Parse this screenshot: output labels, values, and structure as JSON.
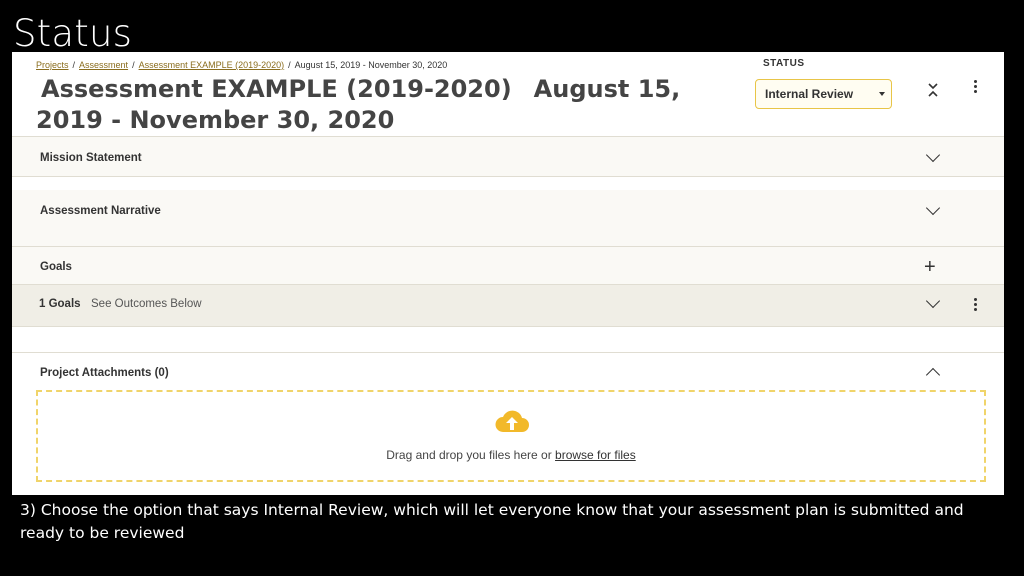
{
  "slide": {
    "title": "Status",
    "caption": "3) Choose the option that says Internal Review, which will let everyone know that your assessment plan is submitted and ready to be reviewed"
  },
  "breadcrumb": {
    "items": [
      "Projects",
      "Assessment",
      "Assessment EXAMPLE (2019-2020)"
    ],
    "current": "August 15, 2019 - November 30, 2020",
    "separator": "/"
  },
  "header": {
    "title_name": "Assessment EXAMPLE (2019-2020)",
    "title_dates": "August 15, 2019 - November 30, 2020"
  },
  "status": {
    "label": "STATUS",
    "selected": "Internal Review"
  },
  "sections": {
    "mission": "Mission Statement",
    "narrative": "Assessment Narrative",
    "goals": "Goals",
    "goals_count": "1 Goals",
    "goals_note": "See Outcomes Below",
    "attachments": "Project Attachments (0)"
  },
  "dropzone": {
    "text": "Drag and drop you files here or ",
    "link": "browse for files"
  },
  "colors": {
    "accent_border": "#e8c547",
    "cloud": "#f2b92a",
    "breadcrumb_link": "#8a6d1e"
  }
}
